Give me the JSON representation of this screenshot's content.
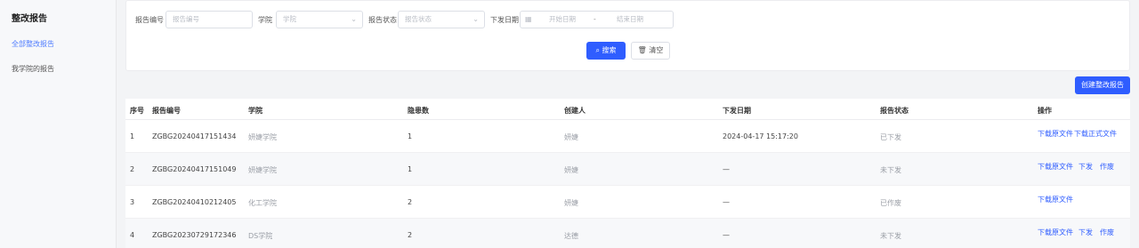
{
  "sidebar": {
    "title": "整改报告",
    "items": [
      {
        "label": "全部整改报告",
        "active": true
      },
      {
        "label": "我学院的报告",
        "active": false
      }
    ]
  },
  "filters": {
    "report_no": {
      "label": "报告编号",
      "placeholder": "报告编号"
    },
    "college": {
      "label": "学院",
      "placeholder": "学院"
    },
    "status": {
      "label": "报告状态",
      "placeholder": "报告状态"
    },
    "date": {
      "label": "下发日期",
      "start_placeholder": "开始日期",
      "separator": "-",
      "end_placeholder": "结束日期"
    },
    "search_button": "搜索",
    "clear_button": "清空"
  },
  "create_button": "创建整改报告",
  "table": {
    "columns": [
      "序号",
      "报告编号",
      "学院",
      "隐患数",
      "创建人",
      "下发日期",
      "报告状态",
      "操作"
    ],
    "rows": [
      {
        "index": "1",
        "report_no": "ZGBG20240417151434",
        "college": "妍婕学院",
        "hazards": "1",
        "creator": "妍婕",
        "date": "2024-04-17 15:17:20",
        "status": "已下发",
        "ops": [
          "下载原文件",
          "下载正式文件"
        ]
      },
      {
        "index": "2",
        "report_no": "ZGBG20240417151049",
        "college": "妍婕学院",
        "hazards": "1",
        "creator": "妍婕",
        "date": "—",
        "status": "未下发",
        "ops": [
          "下载原文件",
          "下发",
          "作废"
        ]
      },
      {
        "index": "3",
        "report_no": "ZGBG20240410212405",
        "college": "化工学院",
        "hazards": "2",
        "creator": "妍婕",
        "date": "—",
        "status": "已作废",
        "ops": [
          "下载原文件"
        ]
      },
      {
        "index": "4",
        "report_no": "ZGBG20230729172346",
        "college": "DS学院",
        "hazards": "2",
        "creator": "达德",
        "date": "—",
        "status": "未下发",
        "ops": [
          "下载原文件",
          "下发",
          "作废"
        ]
      }
    ]
  },
  "colors": {
    "accent": "#2f5dff",
    "sidebar_active": "#4f7cff"
  },
  "icons": {
    "search": "search-icon",
    "clear": "trash-icon",
    "calendar": "calendar-icon",
    "chevron": "chevron-down-icon"
  }
}
